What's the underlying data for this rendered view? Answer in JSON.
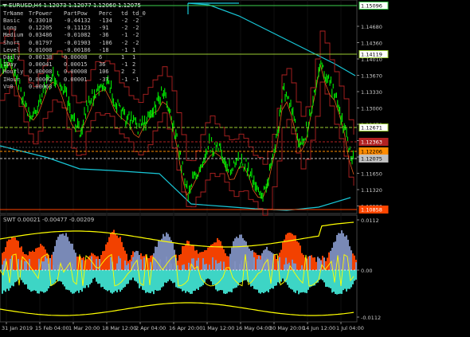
{
  "header": {
    "symbol_line": "EURUSD,H4  1.12073 1.12077 1.12060 1.12075"
  },
  "stats_table": {
    "columns": [
      "TrName",
      "TrPower",
      "PartPow",
      "Perc",
      "td",
      "td_0"
    ],
    "rows": [
      [
        "Basic",
        "0.33010",
        "-0.44132",
        "-134",
        "-2",
        "-2"
      ],
      [
        "Long",
        "0.12205",
        "-0.11123",
        "-91",
        "-2",
        "-2"
      ],
      [
        "Medium",
        "0.03486",
        "-0.01082",
        "-36",
        "-1",
        "-2"
      ],
      [
        "Short",
        "0.01797",
        "-0.01903",
        "-106",
        "-2",
        "-2"
      ],
      [
        "Level",
        "0.01008",
        "-0.00186",
        "-18",
        "-1",
        "1"
      ],
      [
        "Daily",
        "0.00138",
        "0.00008",
        "6",
        "1",
        "1"
      ],
      [
        "IDay",
        "0.00041",
        "0.00015",
        "36",
        "-1",
        "2"
      ],
      [
        "Hourly",
        "0.00008",
        "0.00008",
        "106",
        "2",
        "2"
      ],
      [
        "IHour",
        "0.00002",
        "0.00001",
        "-37",
        "-1",
        "-1"
      ],
      [
        "V=0",
        "0.00063",
        "",
        "",
        "",
        ""
      ]
    ]
  },
  "price_axis": {
    "ticks": [
      "1.14680",
      "1.14360",
      "1.14010",
      "1.13670",
      "1.13330",
      "1.13000",
      "1.12670",
      "1.12330",
      "1.11990",
      "1.11650",
      "1.11320",
      "1.10980"
    ],
    "boxes": [
      {
        "label": "1.15096",
        "bg": "#ffffff",
        "fg": "#000000",
        "border": "#3cd04c"
      },
      {
        "label": "1.14119",
        "bg": "#ffffff",
        "fg": "#000000",
        "border": "#9acd32"
      },
      {
        "label": "1.12671",
        "bg": "#ffffff",
        "fg": "#000000",
        "border": "#9acd32"
      },
      {
        "label": "1.12363",
        "bg": "#b22222",
        "fg": "#ffffff",
        "border": "#b22222"
      },
      {
        "label": "1.12206",
        "bg": "#ff8c00",
        "fg": "#000000",
        "border": "#ff8c00"
      },
      {
        "label": "1.12075",
        "bg": "#c0c0c0",
        "fg": "#000000",
        "border": "#c0c0c0"
      },
      {
        "label": "1.10858",
        "bg": "#ff4500",
        "fg": "#ffffff",
        "border": "#ff4500"
      }
    ]
  },
  "indicator": {
    "label": "SWT 0.00021 -0.00477 -0.00209",
    "ticks": [
      "0.0112",
      "0.00",
      "-0.0112"
    ]
  },
  "time_axis": {
    "labels": [
      "31 Jan 2019",
      "15 Feb 04:00",
      "1 Mar 20:00",
      "18 Mar 12:00",
      "2 Apr 04:00",
      "16 Apr 20:00",
      "1 May 12:00",
      "16 May 04:00",
      "30 May 20:00",
      "14 Jun 12:00",
      "1 Jul 04:00"
    ]
  },
  "colors": {
    "background": "#000000",
    "grid": "#1e2a1e",
    "price": "#00ff00",
    "channel_cyan": "#18c8d8",
    "envelope_red": "#b22222",
    "envelope_orange": "#e05a1a",
    "level_green": "#9acd32",
    "fill_orange": "#ff4500",
    "fill_cyan": "#40e0d0",
    "fill_slate": "#8090c0",
    "yellow": "#ffff00",
    "axis_text": "#c8c8c8"
  }
}
